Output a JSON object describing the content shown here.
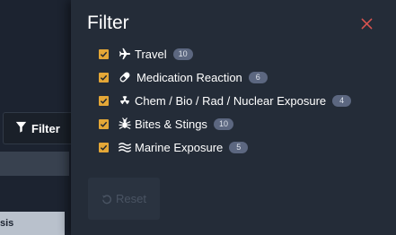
{
  "background": {
    "filter_button_label": "Filter",
    "row_label": "sis"
  },
  "panel": {
    "title": "Filter",
    "reset_label": "Reset",
    "options": [
      {
        "icon": "plane-icon",
        "label": "Travel",
        "count": "10",
        "checked": true
      },
      {
        "icon": "pill-icon",
        "label": "Medication Reaction",
        "count": "6",
        "checked": true
      },
      {
        "icon": "radiation-icon",
        "label": "Chem / Bio / Rad / Nuclear Exposure",
        "count": "4",
        "checked": true
      },
      {
        "icon": "bug-icon",
        "label": "Bites & Stings",
        "count": "10",
        "checked": true
      },
      {
        "icon": "water-icon",
        "label": "Marine Exposure",
        "count": "5",
        "checked": true
      }
    ]
  },
  "colors": {
    "accent": "#e4a737",
    "close": "#d9534f",
    "badge": "#5c6780",
    "panel_bg": "#242c38"
  }
}
